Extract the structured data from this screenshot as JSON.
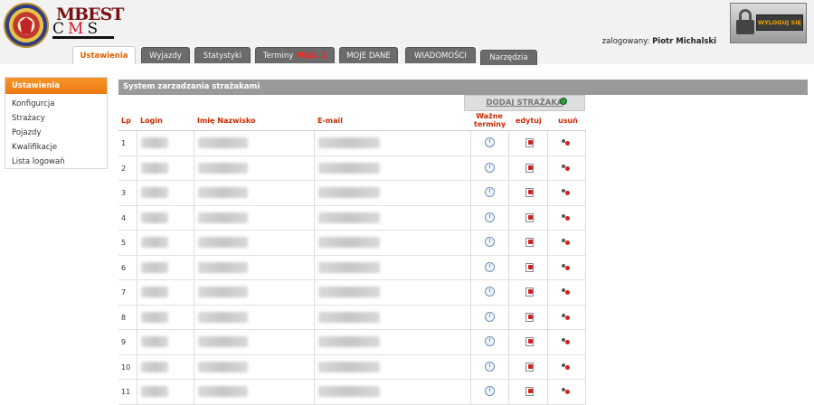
{
  "header": {
    "logo_top": "MBEST",
    "logo_c": "C",
    "logo_m": "M",
    "logo_s": "S",
    "logged_in_label": "zalogowany:",
    "logged_in_user": "Piotr Michalski",
    "logout_label": "WYLOGUJ SIĘ"
  },
  "tabs": [
    {
      "label": "Ustawienia",
      "alert": ""
    },
    {
      "label": "Wyjazdy",
      "alert": ""
    },
    {
      "label": "Statystyki",
      "alert": ""
    },
    {
      "label": "Terminy",
      "alert": "MIJA: 1"
    },
    {
      "label": "MOJE DANE",
      "alert": ""
    },
    {
      "label": "WIADOMOŚCI",
      "alert": ""
    },
    {
      "label": "Narzędzia",
      "alert": ""
    }
  ],
  "sidebar": {
    "title": "Ustawienia",
    "items": [
      "Konfigurcja",
      "Strażacy",
      "Pojazdy",
      "Kwalifikacje",
      "Lista logowań"
    ]
  },
  "main": {
    "title": "System zarzadzania strażakami",
    "add_button": "DODAJ STRAŻAKA",
    "columns": {
      "lp": "Lp",
      "login": "Login",
      "name": "Imię Nazwisko",
      "email": "E-mail",
      "valid_line1": "Ważne",
      "valid_line2": "terminy",
      "edit": "edytuj",
      "delete": "usuń"
    },
    "rows": [
      "1",
      "2",
      "3",
      "4",
      "5",
      "6",
      "7",
      "8",
      "9",
      "10",
      "11"
    ]
  },
  "colors": {
    "accent": "#ee7a10",
    "header_text": "#cc2a00",
    "tab_bg": "#6b6b6b",
    "bar_bg": "#9a9a9a"
  }
}
